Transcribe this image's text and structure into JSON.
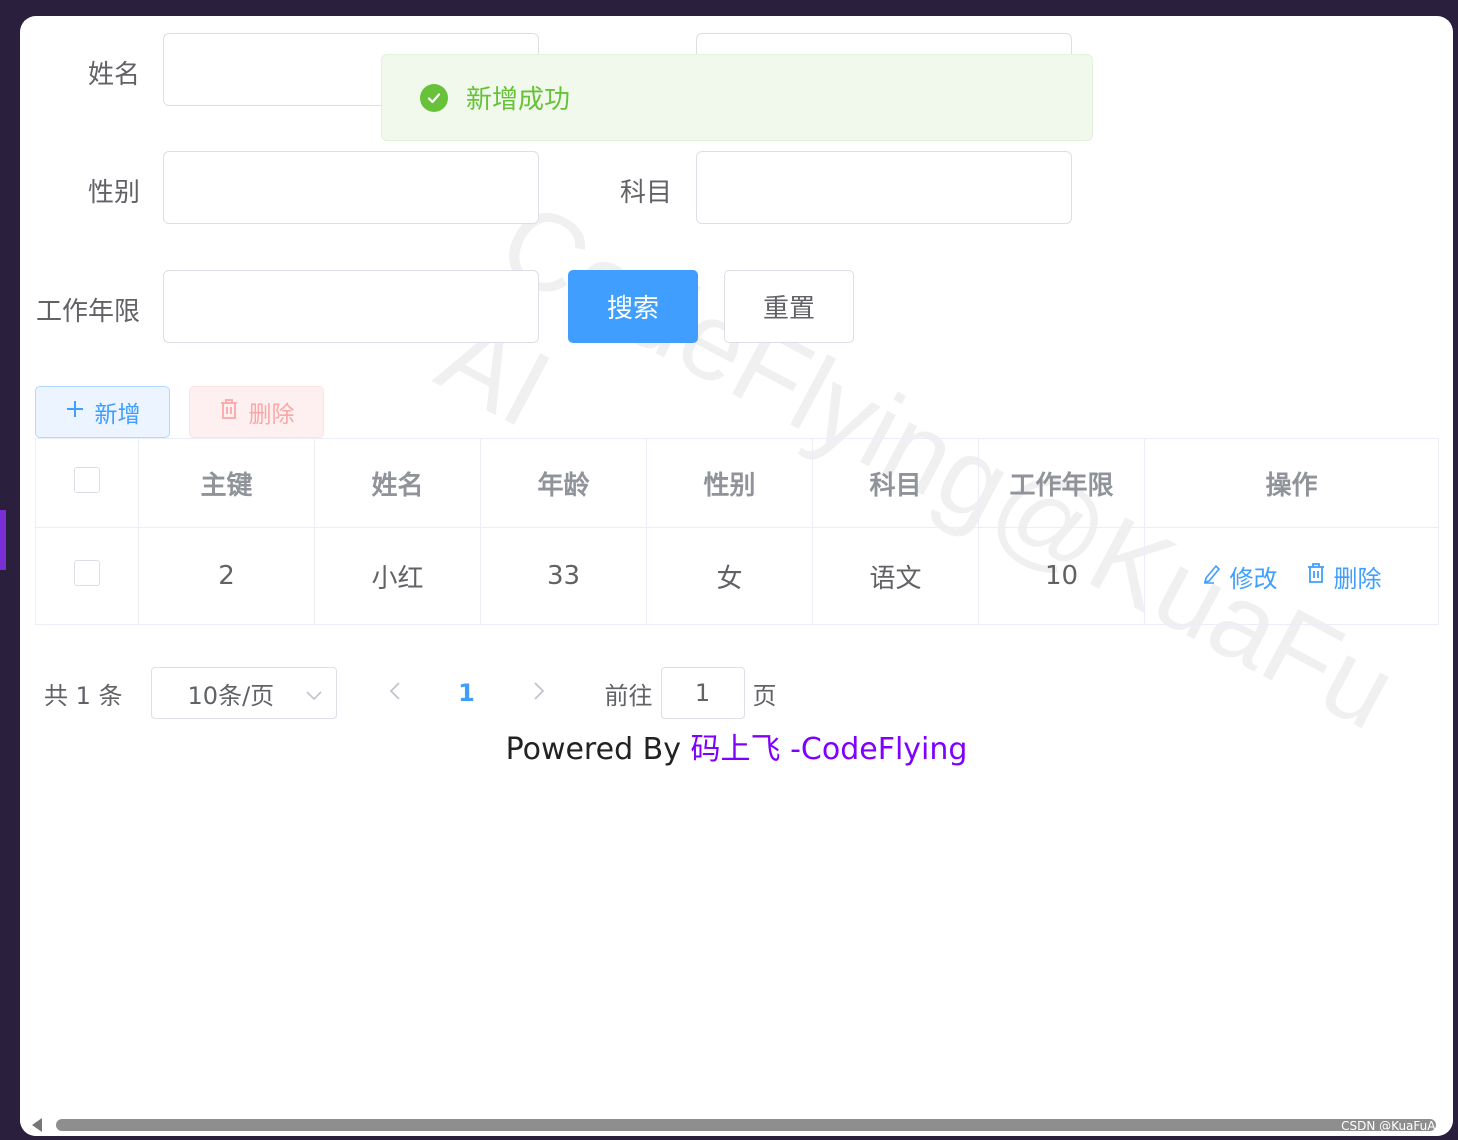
{
  "form": {
    "name_label": "姓名",
    "gender_label": "性别",
    "subject_label": "科目",
    "years_label": "工作年限",
    "search_button": "搜索",
    "reset_button": "重置"
  },
  "toast": {
    "message": "新增成功"
  },
  "toolbar": {
    "add_button": "新增",
    "delete_button": "删除"
  },
  "table": {
    "headers": [
      "主键",
      "姓名",
      "年龄",
      "性别",
      "科目",
      "工作年限",
      "操作"
    ],
    "rows": [
      {
        "id": "2",
        "name": "小红",
        "age": "33",
        "gender": "女",
        "subject": "语文",
        "years": "10"
      }
    ],
    "edit_label": "修改",
    "delete_label": "删除"
  },
  "pagination": {
    "total": "共 1 条",
    "page_size": "10条/页",
    "current_page": "1",
    "goto_label": "前往",
    "goto_value": "1",
    "page_suffix": "页"
  },
  "footer": {
    "powered_by": "Powered By",
    "link_text": "码上飞 -CodeFlying"
  },
  "watermark": {
    "line1": "CodeFlying@KuaFu",
    "line2": "AI"
  },
  "csdn_mark": "CSDN @KuaFuAI",
  "colors": {
    "primary": "#409eff",
    "success": "#67c23a",
    "danger": "#f56c6c",
    "link": "#7f00ff"
  }
}
